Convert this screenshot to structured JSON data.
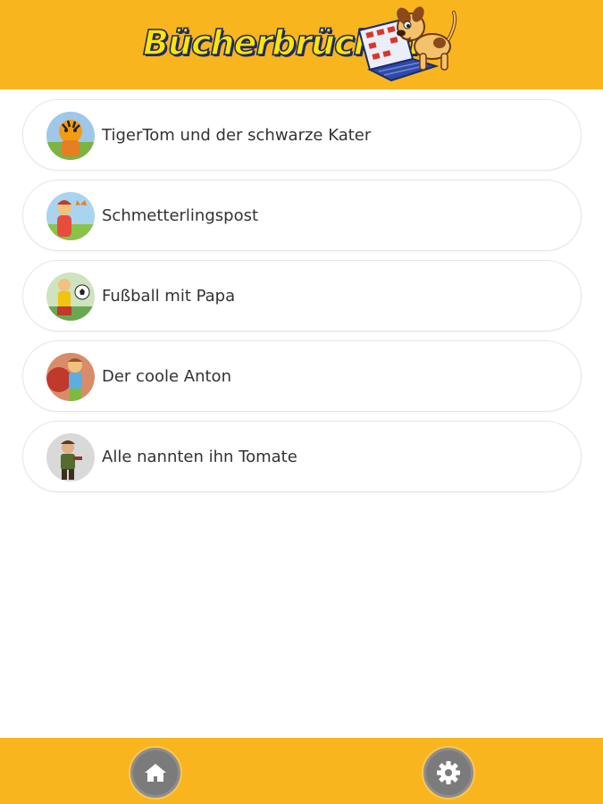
{
  "header": {
    "logo_text": "Bücherbrücken",
    "brand_color": "#f8b51e"
  },
  "books": [
    {
      "title": "TigerTom und der schwarze Kater",
      "icon": "tiger-cover-thumbnail"
    },
    {
      "title": "Schmetterlingspost",
      "icon": "butterfly-cover-thumbnail"
    },
    {
      "title": "Fußball mit Papa",
      "icon": "football-cover-thumbnail"
    },
    {
      "title": "Der coole Anton",
      "icon": "anton-cover-thumbnail"
    },
    {
      "title": "Alle nannten ihn Tomate",
      "icon": "tomate-cover-thumbnail"
    }
  ],
  "footer": {
    "home_icon": "home-icon",
    "settings_icon": "gear-icon"
  }
}
